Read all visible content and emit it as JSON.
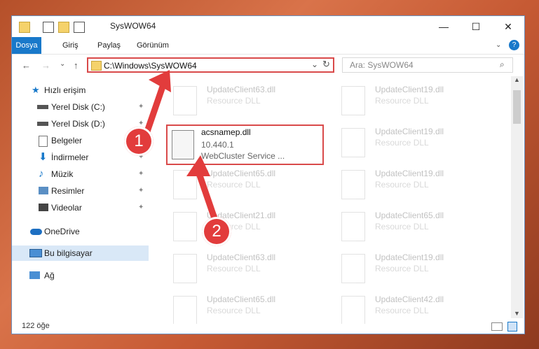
{
  "window": {
    "title": "SysWOW64",
    "minimize_glyph": "—",
    "maximize_glyph": "☐",
    "close_glyph": "✕"
  },
  "ribbon": {
    "tabs": [
      "Dosya",
      "Giriş",
      "Paylaş",
      "Görünüm"
    ],
    "help_glyph": "?"
  },
  "nav": {
    "back": "←",
    "forward": "→",
    "recent": "⌄",
    "up": "↑",
    "address": "C:\\Windows\\SysWOW64",
    "refresh": "↻",
    "dropdown": "⌄"
  },
  "search": {
    "placeholder": "Ara: SysWOW64"
  },
  "sidebar": {
    "items": [
      {
        "label": "Hızlı erişim",
        "icon": "star-icon"
      },
      {
        "label": "Yerel Disk (C:)",
        "icon": "drive-icon"
      },
      {
        "label": "Yerel Disk (D:)",
        "icon": "drive-icon"
      },
      {
        "label": "Belgeler",
        "icon": "documents-icon"
      },
      {
        "label": "İndirmeler",
        "icon": "download-icon"
      },
      {
        "label": "Müzik",
        "icon": "music-icon"
      },
      {
        "label": "Resimler",
        "icon": "pictures-icon"
      },
      {
        "label": "Videolar",
        "icon": "videos-icon"
      },
      {
        "label": "OneDrive",
        "icon": "cloud-icon"
      },
      {
        "label": "Bu bilgisayar",
        "icon": "computer-icon"
      },
      {
        "label": "Ağ",
        "icon": "network-icon"
      }
    ]
  },
  "files": [
    {
      "name": "UpdateClient63.dll",
      "desc": "Resource DLL"
    },
    {
      "name": "UpdateClient19.dll",
      "desc": "Resource DLL"
    },
    {
      "name": "UpdateClient19.dll",
      "desc": "Resource DLL"
    },
    {
      "name": "UpdateClient65.dll",
      "desc": "Resource DLL"
    },
    {
      "name": "UpdateClient19.dll",
      "desc": "Resource DLL"
    },
    {
      "name": "UpdateClient21.dll",
      "desc": "Resource DLL"
    },
    {
      "name": "UpdateClient65.dll",
      "desc": "Resource DLL"
    },
    {
      "name": "UpdateClient63.dll",
      "desc": "Resource DLL"
    },
    {
      "name": "UpdateClient19.dll",
      "desc": "Resource DLL"
    },
    {
      "name": "UpdateClient65.dll",
      "desc": "Resource DLL"
    },
    {
      "name": "UpdateClient42.dll",
      "desc": "Resource DLL"
    }
  ],
  "selected_file": {
    "name": "acsnamep.dll",
    "version": "10.440.1",
    "desc": "WebCluster Service ..."
  },
  "status": {
    "count": "122 öğe"
  },
  "callouts": {
    "one": "1",
    "two": "2"
  },
  "colors": {
    "accent": "#1979ca",
    "highlight": "#d94a4a"
  }
}
